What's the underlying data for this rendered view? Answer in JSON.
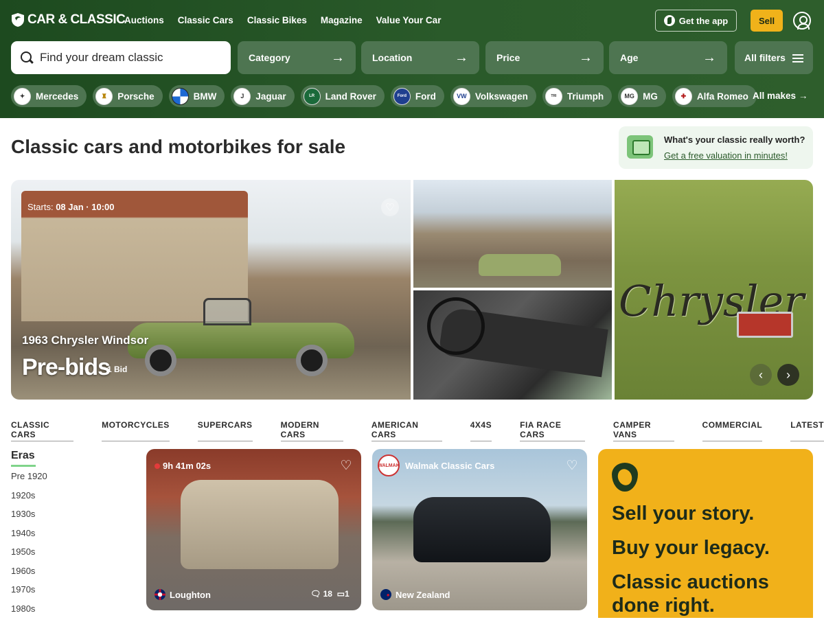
{
  "header": {
    "logo_text": "CAR & CLASSIC",
    "nav": [
      "Auctions",
      "Classic Cars",
      "Classic Bikes",
      "Magazine",
      "Value Your Car"
    ],
    "get_app": "Get the app",
    "sell": "Sell"
  },
  "search": {
    "placeholder": "Find your dream classic",
    "filters": [
      "Category",
      "Location",
      "Price",
      "Age"
    ],
    "all_filters": "All filters"
  },
  "makes": {
    "items": [
      {
        "label": "Mercedes",
        "icon": "mercedes-logo-icon"
      },
      {
        "label": "Porsche",
        "icon": "porsche-logo-icon"
      },
      {
        "label": "BMW",
        "icon": "bmw-logo-icon"
      },
      {
        "label": "Jaguar",
        "icon": "jaguar-logo-icon"
      },
      {
        "label": "Land Rover",
        "icon": "land-rover-logo-icon"
      },
      {
        "label": "Ford",
        "icon": "ford-logo-icon"
      },
      {
        "label": "Volkswagen",
        "icon": "volkswagen-logo-icon"
      },
      {
        "label": "Triumph",
        "icon": "triumph-logo-icon"
      },
      {
        "label": "MG",
        "icon": "mg-logo-icon"
      },
      {
        "label": "Alfa Romeo",
        "icon": "alfa-romeo-logo-icon"
      }
    ],
    "all_makes": "All makes"
  },
  "page_title": "Classic cars and motorbikes for sale",
  "valuation": {
    "question": "What's your classic really worth?",
    "link": "Get a free valuation in minutes!"
  },
  "hero": {
    "starts_label": "Starts:",
    "starts_value": "08 Jan · 10:00",
    "title": "1963 Chrysler Windsor",
    "status": "Pre-bids",
    "bids": "1 Bid"
  },
  "categories": [
    "CLASSIC CARS",
    "MOTORCYCLES",
    "SUPERCARS",
    "MODERN CARS",
    "AMERICAN CARS",
    "4X4S",
    "FIA RACE CARS",
    "CAMPER VANS",
    "COMMERCIAL",
    "LATEST"
  ],
  "eras": {
    "title": "Eras",
    "items": [
      "Pre 1920",
      "1920s",
      "1930s",
      "1940s",
      "1950s",
      "1960s",
      "1970s",
      "1980s"
    ]
  },
  "listings": [
    {
      "timer": "9h 41m 02s",
      "location": "Loughton",
      "comments": "18",
      "videos": "1"
    },
    {
      "dealer": "Walmak Classic Cars",
      "location": "New Zealand"
    }
  ],
  "promo": {
    "lines": [
      "Sell your story.",
      "Buy your legacy.",
      "Classic auctions done right."
    ]
  },
  "colors": {
    "brand_green": "#1d4a1f",
    "accent_yellow": "#f0b21a",
    "chip_green": "#4e7551"
  }
}
